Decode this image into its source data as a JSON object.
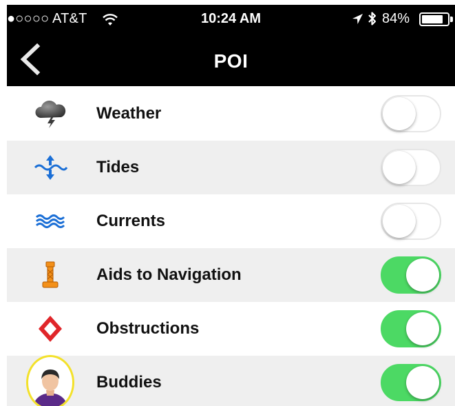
{
  "status_bar": {
    "carrier": "●○○○○ AT&T",
    "time": "10:24 AM",
    "battery_percent": "84%",
    "battery_level": 0.84,
    "icons": [
      "wifi-icon",
      "location-arrow-icon",
      "bluetooth-icon",
      "battery-icon"
    ]
  },
  "nav": {
    "title": "POI",
    "back_icon": "chevron-left-icon"
  },
  "colors": {
    "toggle_on": "#4cd964",
    "row_shaded": "#efefef",
    "buddy_ring": "#f3e12a"
  },
  "rows": [
    {
      "label": "Weather",
      "icon": "storm-cloud-icon",
      "enabled": false
    },
    {
      "label": "Tides",
      "icon": "tides-icon",
      "enabled": false
    },
    {
      "label": "Currents",
      "icon": "waves-icon",
      "enabled": false
    },
    {
      "label": "Aids to Navigation",
      "icon": "buoy-icon",
      "enabled": true
    },
    {
      "label": "Obstructions",
      "icon": "diamond-marker-icon",
      "enabled": true
    },
    {
      "label": "Buddies",
      "icon": "buddy-avatar-icon",
      "enabled": true
    }
  ]
}
